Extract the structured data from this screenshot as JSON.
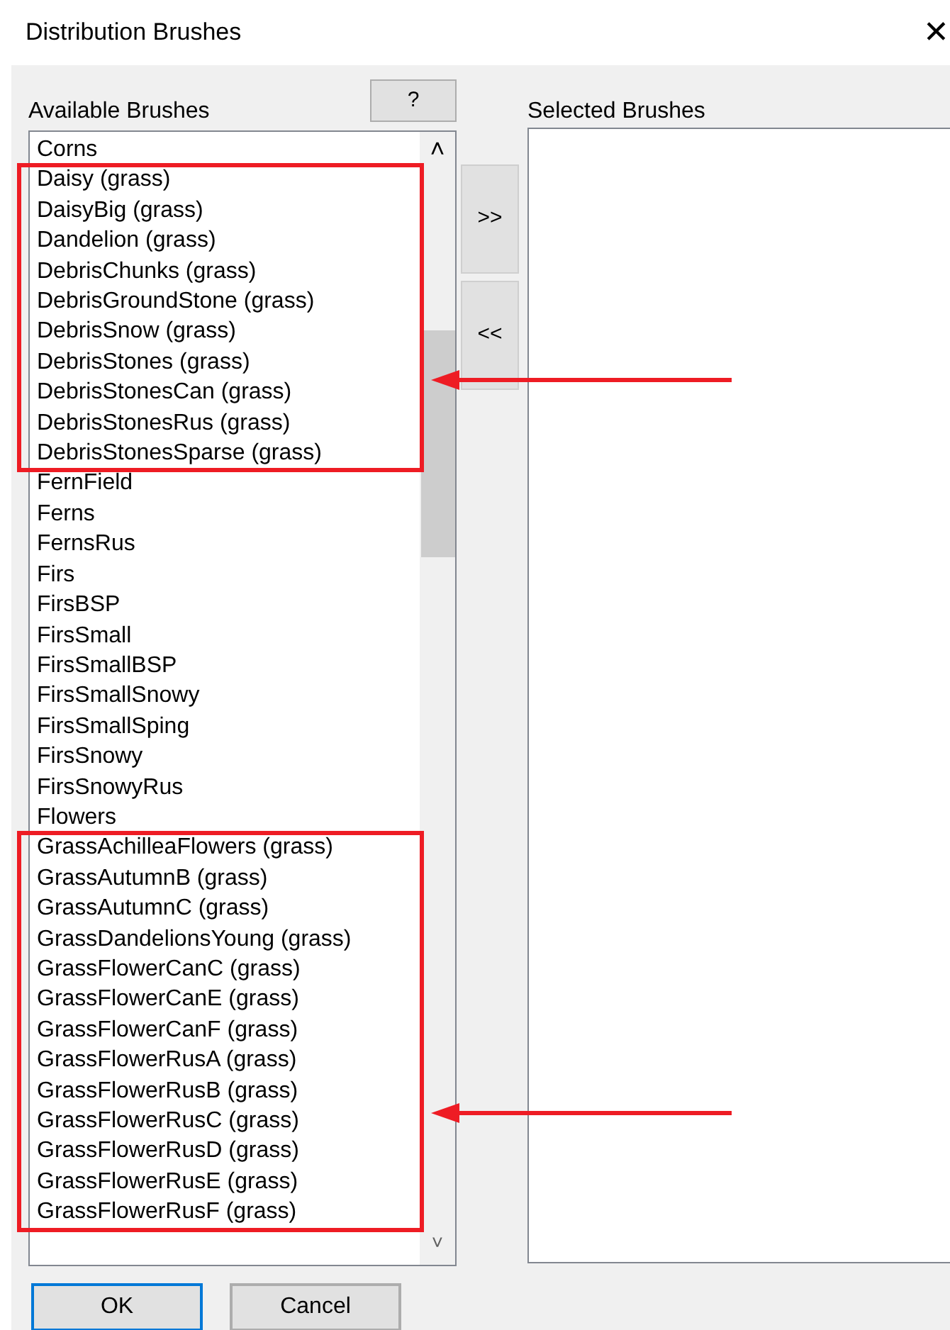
{
  "window": {
    "title": "Distribution Brushes",
    "close": "✕"
  },
  "available": {
    "label": "Available Brushes",
    "help_button": "?",
    "scroll_up": "˄",
    "scroll_down": "˅",
    "groups": [
      {
        "highlighted": false,
        "items": [
          "Corns"
        ]
      },
      {
        "highlighted": true,
        "items": [
          "Daisy (grass)",
          "DaisyBig (grass)",
          "Dandelion (grass)",
          "DebrisChunks (grass)",
          "DebrisGroundStone (grass)",
          "DebrisSnow (grass)",
          "DebrisStones (grass)",
          "DebrisStonesCan (grass)",
          "DebrisStonesRus (grass)",
          "DebrisStonesSparse (grass)"
        ]
      },
      {
        "highlighted": false,
        "items": [
          "FernField",
          "Ferns",
          "FernsRus",
          "Firs",
          "FirsBSP",
          "FirsSmall",
          "FirsSmallBSP",
          "FirsSmallSnowy",
          "FirsSmallSping",
          "FirsSnowy",
          "FirsSnowyRus",
          "Flowers"
        ]
      },
      {
        "highlighted": true,
        "items": [
          "GrassAchilleaFlowers (grass)",
          "GrassAutumnB (grass)",
          "GrassAutumnC (grass)",
          "GrassDandelionsYoung (grass)",
          "GrassFlowerCanC (grass)",
          "GrassFlowerCanE (grass)",
          "GrassFlowerCanF (grass)",
          "GrassFlowerRusA (grass)",
          "GrassFlowerRusB (grass)",
          "GrassFlowerRusC (grass)",
          "GrassFlowerRusD (grass)",
          "GrassFlowerRusE (grass)",
          "GrassFlowerRusF (grass)"
        ]
      }
    ]
  },
  "move_buttons": [
    {
      "label": ">>"
    },
    {
      "label": "<<"
    }
  ],
  "selected": {
    "label": "Selected Brushes"
  },
  "buttons": [
    {
      "label": "OK",
      "default": true
    },
    {
      "label": "Cancel",
      "default": false
    }
  ]
}
